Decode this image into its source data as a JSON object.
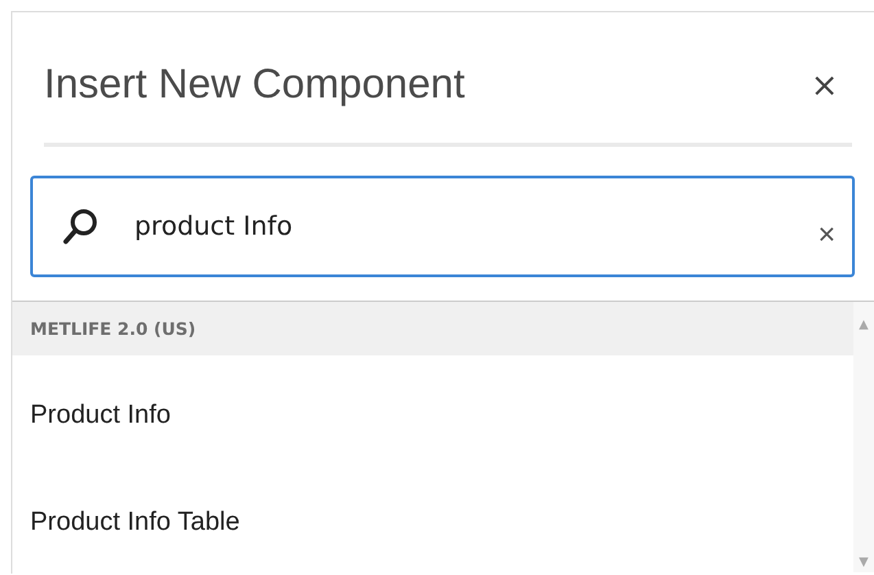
{
  "dialog": {
    "title": "Insert New Component",
    "close": "×"
  },
  "search": {
    "value": "product Info",
    "clear": "×"
  },
  "groups": [
    {
      "title": "METLIFE 2.0 (US)",
      "items": [
        {
          "label": "Product Info"
        },
        {
          "label": "Product Info Table"
        }
      ]
    }
  ],
  "scrollbar": {
    "up": "▲",
    "down": "▼"
  }
}
